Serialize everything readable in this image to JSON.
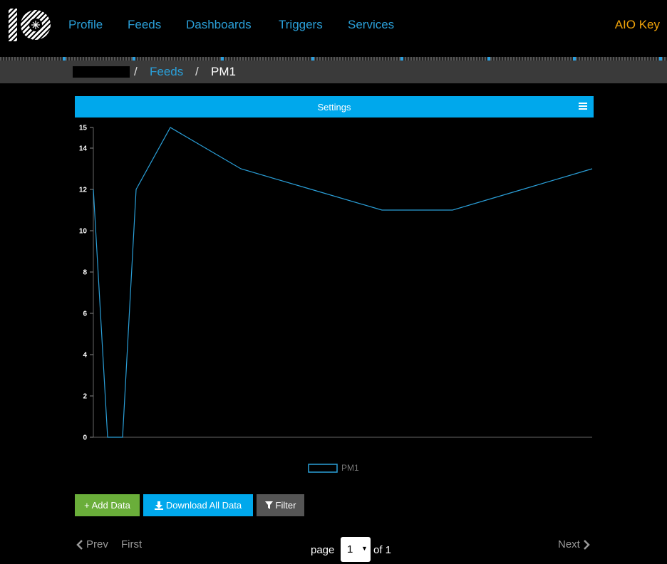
{
  "nav": {
    "items": [
      {
        "label": "Profile",
        "left": 96
      },
      {
        "label": "Feeds",
        "left": 179
      },
      {
        "label": "Dashboards",
        "left": 261
      },
      {
        "label": "Triggers",
        "left": 391
      },
      {
        "label": "Services",
        "left": 488
      }
    ],
    "aio_key": "AIO Key"
  },
  "breadcrumb": {
    "sep": "/",
    "feeds": "Feeds",
    "current": "PM1"
  },
  "settings": {
    "label": "Settings"
  },
  "chart_data": {
    "type": "line",
    "series": [
      {
        "name": "PM1",
        "color": "#2a9fd8",
        "x": [
          0,
          1,
          2,
          3,
          4,
          5,
          6,
          7,
          8,
          9,
          10
        ],
        "values": [
          12,
          0,
          0,
          12,
          15,
          13,
          12,
          11,
          11,
          12,
          13
        ]
      }
    ],
    "yticks": [
      0,
      2,
      4,
      6,
      8,
      10,
      12,
      14,
      15
    ],
    "ylim": [
      0,
      15
    ],
    "legend": "bottom"
  },
  "buttons": {
    "add": "+ Add Data",
    "download": "Download All Data",
    "filter": "Filter"
  },
  "pagination": {
    "prev": "Prev",
    "first": "First",
    "next": "Next",
    "page": "page",
    "current": "1",
    "of": "of 1"
  },
  "colors": {
    "accent": "#00a8ec",
    "link": "#2a9fd8",
    "key": "#f0a30a",
    "add": "#6aae3a"
  }
}
